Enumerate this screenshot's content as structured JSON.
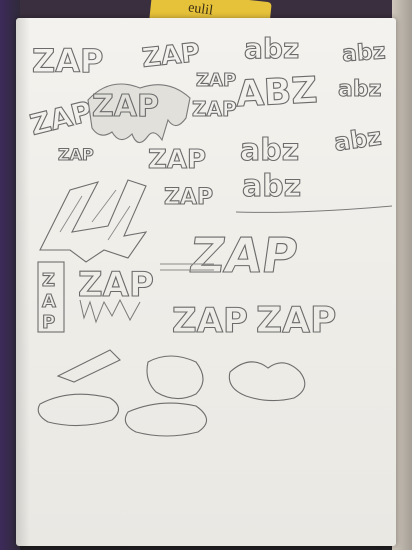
{
  "photo": {
    "label_on_yellow_item": "eulil",
    "sketches": [
      {
        "id": "zap-1",
        "text": "ZAP"
      },
      {
        "id": "zap-2",
        "text": "ZAP"
      },
      {
        "id": "zap-3",
        "text": "ZAP"
      },
      {
        "id": "zap-4",
        "text": "ZAP"
      },
      {
        "id": "zap-5",
        "text": "ZAP"
      },
      {
        "id": "zap-6",
        "text": "ZAP"
      },
      {
        "id": "zap-7",
        "text": "ZAP"
      },
      {
        "id": "zap-8",
        "text": "ZAP"
      },
      {
        "id": "zap-9",
        "text": "ZAP"
      },
      {
        "id": "zap-10",
        "text": "ZAP"
      },
      {
        "id": "zap-11",
        "text": "ZAP"
      },
      {
        "id": "zap-12",
        "text": "ZAP"
      },
      {
        "id": "zap-13",
        "text": "ZAP"
      },
      {
        "id": "abz-1",
        "text": "abz"
      },
      {
        "id": "abz-2",
        "text": "ABZ"
      },
      {
        "id": "abz-3",
        "text": "abz"
      },
      {
        "id": "abz-4",
        "text": "abz"
      },
      {
        "id": "abz-5",
        "text": "abz"
      },
      {
        "id": "abz-6",
        "text": "abz"
      },
      {
        "id": "abz-7",
        "text": "abz"
      }
    ]
  }
}
